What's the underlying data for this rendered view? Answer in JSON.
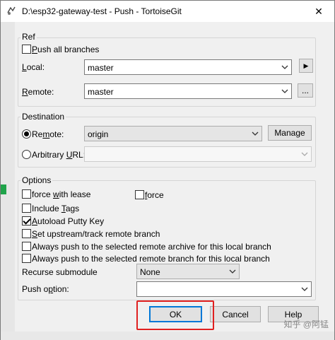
{
  "window": {
    "title": "D:\\esp32-gateway-test - Push - TortoiseGit",
    "close_glyph": "✕"
  },
  "ref": {
    "group_label": "Ref",
    "push_all_branches": {
      "label_first": "P",
      "label_rest": "ush all branches",
      "checked": false
    },
    "local": {
      "label_first": "L",
      "label_rest": "ocal:",
      "value": "master",
      "button_glyph": "▶"
    },
    "remote": {
      "label_first": "R",
      "label_rest": "emote:",
      "value": "master",
      "button_label": "..."
    }
  },
  "destination": {
    "group_label": "Destination",
    "remote": {
      "label_first": "Re",
      "label_u": "m",
      "label_rest": "ote:",
      "value": "origin",
      "selected": true,
      "manage_label": "Manage"
    },
    "arbitrary_url": {
      "label_first": "Arbitrary ",
      "label_u": "U",
      "label_rest": "RL:",
      "value": "",
      "selected": false
    }
  },
  "options": {
    "group_label": "Options",
    "force_with_lease": {
      "label_first": "force ",
      "label_u": "w",
      "label_rest": "ith lease",
      "checked": false
    },
    "force": {
      "label_u": "f",
      "label_rest": "orce",
      "checked": false
    },
    "include_tags": {
      "label_first": "Include ",
      "label_u": "T",
      "label_rest": "ags",
      "checked": false
    },
    "autoload_putty_key": {
      "label_u": "A",
      "label_rest": "utoload Putty Key",
      "checked": true
    },
    "set_upstream": {
      "label_u": "S",
      "label_rest": "et upstream/track remote branch",
      "checked": false
    },
    "always_push_archive": {
      "label": "Always push to the selected remote archive for this local branch",
      "checked": false
    },
    "always_push_branch": {
      "label": "Always push to the selected remote branch for this local branch",
      "checked": false
    },
    "recurse_submodule": {
      "label": "Recurse submodule",
      "value": "None"
    },
    "push_option": {
      "label_first": "Push o",
      "label_u": "p",
      "label_rest": "tion:",
      "value": ""
    }
  },
  "buttons": {
    "ok": "OK",
    "cancel": "Cancel",
    "help": "Help"
  },
  "watermark": "知乎 @阿锰",
  "colors": {
    "highlight": "#e02020",
    "default_button_border": "#0078d7"
  }
}
